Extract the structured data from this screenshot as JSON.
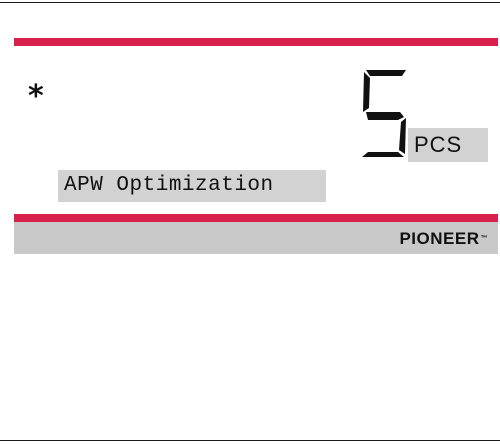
{
  "display": {
    "stability_indicator": "*",
    "count_value": "5",
    "unit": "PCS",
    "message": "APW Optimization",
    "accent_color": "#d91f4c",
    "panel_color": "#c8c8c8"
  },
  "brand": {
    "name": "PIONEER",
    "trademark": "™"
  }
}
